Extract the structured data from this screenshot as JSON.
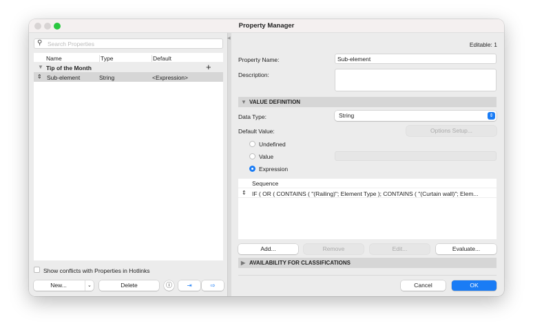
{
  "window": {
    "title": "Property Manager"
  },
  "left": {
    "search_placeholder": "Search Properties",
    "columns": [
      "Name",
      "Type",
      "Default"
    ],
    "group": {
      "name": "Tip of the Month"
    },
    "rows": [
      {
        "name": "Sub-element",
        "type": "String",
        "default": "<Expression>"
      }
    ],
    "show_conflicts_label": "Show conflicts with Properties in Hotlinks",
    "new_label": "New...",
    "delete_label": "Delete"
  },
  "right": {
    "editable": "Editable: 1",
    "property_name_label": "Property Name:",
    "property_name_value": "Sub-element",
    "description_label": "Description:",
    "value_definition": "VALUE DEFINITION",
    "data_type_label": "Data Type:",
    "data_type_value": "String",
    "default_value_label": "Default Value:",
    "options_setup": "Options Setup...",
    "radio": [
      "Undefined",
      "Value",
      "Expression"
    ],
    "selected_radio": "Expression",
    "sequence_header": "Sequence",
    "expression": "IF ( OR ( CONTAINS ( \"(Railing)\"; Element Type ); CONTAINS ( \"(Curtain wall)\"; Elem...",
    "add": "Add...",
    "remove": "Remove",
    "edit": "Edit...",
    "evaluate": "Evaluate...",
    "availability": "AVAILABILITY FOR CLASSIFICATIONS",
    "cancel": "Cancel",
    "ok": "OK"
  },
  "colors": {
    "accent": "#1a7cf5",
    "close_green": "#2ac840"
  }
}
